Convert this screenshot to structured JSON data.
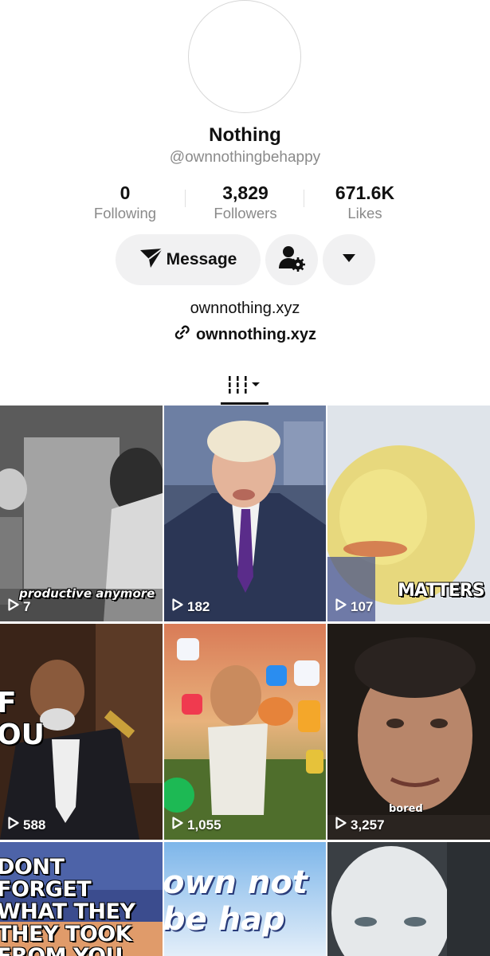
{
  "profile": {
    "name": "Nothing",
    "handle": "@ownnothingbehappy",
    "bio": "ownnothing.xyz",
    "link": "ownnothing.xyz"
  },
  "stats": [
    {
      "value": "0",
      "label": "Following"
    },
    {
      "value": "3,829",
      "label": "Followers"
    },
    {
      "value": "671.6K",
      "label": "Likes"
    }
  ],
  "actions": {
    "message_label": "Message",
    "add_friend_icon": "person-gear-icon",
    "more_icon": "caret-down-icon"
  },
  "tabs": {
    "videos_icon": "grid-bars-icon"
  },
  "videos": [
    {
      "views": "7",
      "caption": "productive anymore"
    },
    {
      "views": "182",
      "caption": ""
    },
    {
      "views": "107",
      "caption": "MATTERS"
    },
    {
      "views": "588",
      "caption": "F OU"
    },
    {
      "views": "1,055",
      "caption": ""
    },
    {
      "views": "3,257",
      "caption": "bored"
    },
    {
      "views": "",
      "caption": "DONT FORGET WHAT THEY THEY TOOK FROM YOU"
    },
    {
      "views": "",
      "caption": "own not be hap"
    },
    {
      "views": "",
      "caption": ""
    }
  ],
  "colors": {
    "button_bg": "#f1f1f2",
    "muted_text": "#8a8a8a"
  }
}
